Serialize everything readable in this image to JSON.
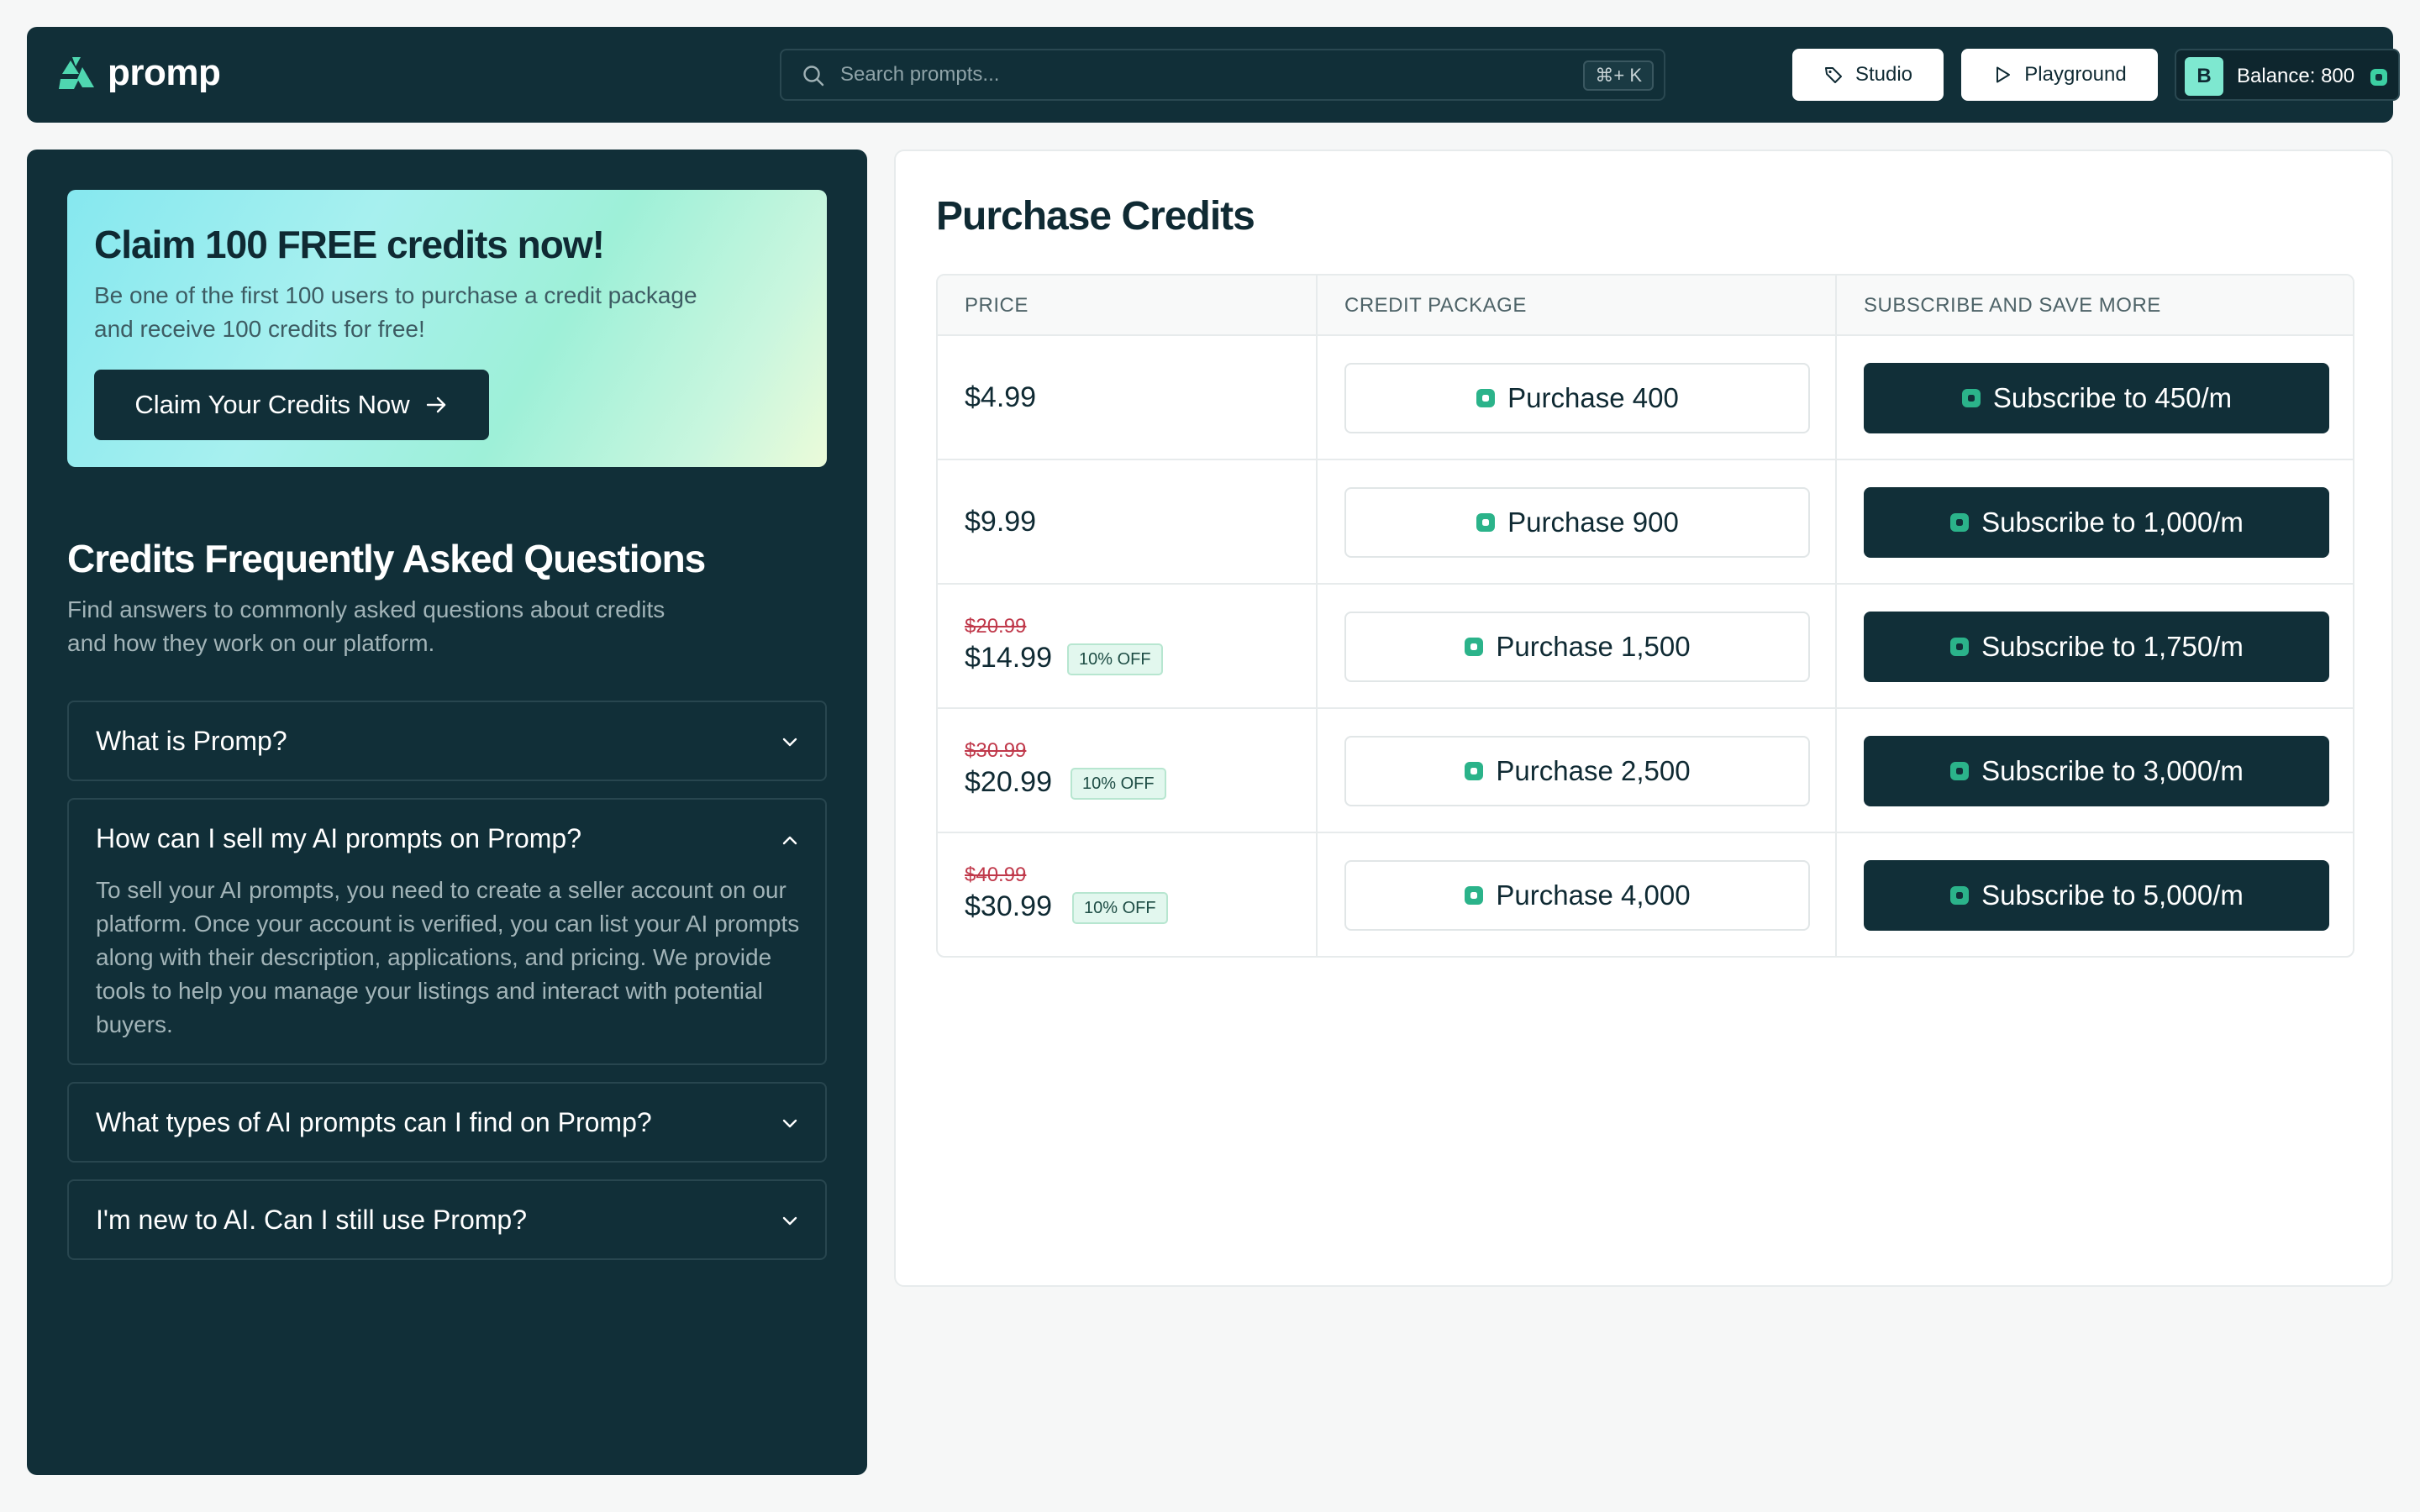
{
  "header": {
    "logo_text": "promp",
    "search_placeholder": "Search prompts...",
    "search_shortcut": "⌘+ K",
    "studio_label": "Studio",
    "playground_label": "Playground",
    "avatar_initial": "B",
    "balance_label": "Balance: 800",
    "logo_icon": "promp-logo-icon",
    "search_icon": "search-icon",
    "studio_icon": "tag-icon",
    "playground_icon": "play-icon",
    "coin_icon": "credit-coin-icon"
  },
  "promo": {
    "title": "Claim 100 FREE credits now!",
    "description": "Be one of the first 100 users to purchase a credit package and receive 100 credits for free!",
    "cta_label": "Claim Your Credits Now"
  },
  "faq": {
    "title": "Credits Frequently Asked Questions",
    "subtitle": "Find answers to commonly asked questions about credits and how they work on our platform.",
    "items": [
      {
        "question": "What is Promp?",
        "expanded": false
      },
      {
        "question": "How can I sell my AI prompts on Promp?",
        "expanded": true,
        "answer": "To sell your AI prompts, you need to create a seller account on our platform. Once your account is verified, you can list your AI prompts along with their description, applications, and pricing. We provide tools to help you manage your listings and interact with potential buyers."
      },
      {
        "question": "What types of AI prompts can I find on Promp?",
        "expanded": false
      },
      {
        "question": "I'm new to AI. Can I still use Promp?",
        "expanded": false
      }
    ]
  },
  "purchase": {
    "title": "Purchase Credits",
    "columns": [
      "PRICE",
      "CREDIT PACKAGE",
      "SUBSCRIBE AND SAVE MORE"
    ],
    "rows": [
      {
        "price": "$4.99",
        "purchase_label": "Purchase 400",
        "subscribe_label": "Subscribe to 450/m"
      },
      {
        "price": "$9.99",
        "purchase_label": "Purchase 900",
        "subscribe_label": "Subscribe to 1,000/m"
      },
      {
        "old_price": "$20.99",
        "price": "$14.99",
        "discount": "10% OFF",
        "purchase_label": "Purchase 1,500",
        "subscribe_label": "Subscribe to 1,750/m"
      },
      {
        "old_price": "$30.99",
        "price": "$20.99",
        "discount": "10% OFF",
        "purchase_label": "Purchase 2,500",
        "subscribe_label": "Subscribe to 3,000/m"
      },
      {
        "old_price": "$40.99",
        "price": "$30.99",
        "discount": "10% OFF",
        "purchase_label": "Purchase 4,000",
        "subscribe_label": "Subscribe to 5,000/m"
      }
    ]
  },
  "colors": {
    "brand_dark": "#112f38",
    "accent_green": "#2bb38a",
    "strike_red": "#c0394b"
  }
}
